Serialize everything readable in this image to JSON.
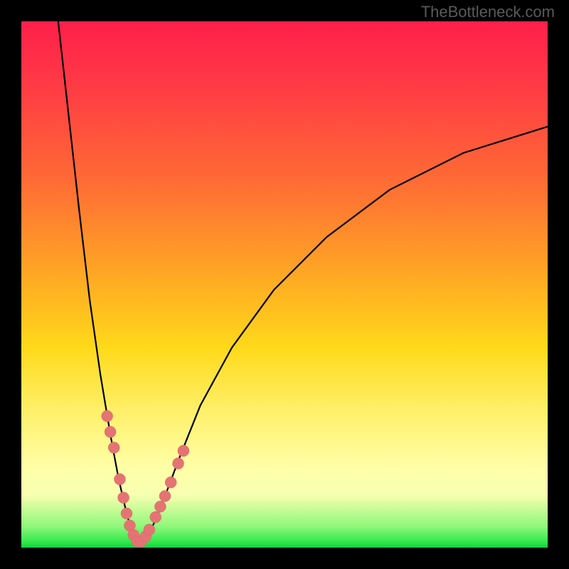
{
  "watermark": "TheBottleneck.com",
  "colors": {
    "frame": "#000000",
    "curve": "#000000",
    "marker_fill": "#e47473",
    "marker_stroke": "#d86462",
    "gradient_stops": [
      {
        "pos": 0,
        "hex": "#ff1f4a"
      },
      {
        "pos": 12,
        "hex": "#ff3a45"
      },
      {
        "pos": 30,
        "hex": "#ff6a35"
      },
      {
        "pos": 48,
        "hex": "#ffa724"
      },
      {
        "pos": 62,
        "hex": "#ffd91a"
      },
      {
        "pos": 74,
        "hex": "#fff06a"
      },
      {
        "pos": 85,
        "hex": "#ffffa8"
      },
      {
        "pos": 90,
        "hex": "#f7ffb0"
      },
      {
        "pos": 96,
        "hex": "#8ef77a"
      },
      {
        "pos": 99,
        "hex": "#2ee84c"
      },
      {
        "pos": 100,
        "hex": "#10d040"
      }
    ]
  },
  "chart_data": {
    "type": "line",
    "title": "",
    "xlabel": "",
    "ylabel": "",
    "xlim": [
      0,
      100
    ],
    "ylim": [
      0,
      100
    ],
    "note": "V-shaped bottleneck curve with vertex near x≈22, y≈0. Left branch from (7,100) down to vertex; right branch rises toward (100,80). Salmon markers cluster near the vertex on both branches.",
    "series": [
      {
        "name": "bottleneck_curve",
        "points": [
          {
            "x": 7.0,
            "y": 100.0
          },
          {
            "x": 9.0,
            "y": 82.0
          },
          {
            "x": 11.0,
            "y": 64.0
          },
          {
            "x": 13.0,
            "y": 47.0
          },
          {
            "x": 15.0,
            "y": 33.0
          },
          {
            "x": 17.0,
            "y": 21.0
          },
          {
            "x": 18.5,
            "y": 13.0
          },
          {
            "x": 20.0,
            "y": 6.5
          },
          {
            "x": 21.0,
            "y": 3.0
          },
          {
            "x": 22.0,
            "y": 1.0
          },
          {
            "x": 23.0,
            "y": 1.0
          },
          {
            "x": 24.5,
            "y": 3.0
          },
          {
            "x": 27.0,
            "y": 9.0
          },
          {
            "x": 30.0,
            "y": 17.0
          },
          {
            "x": 34.0,
            "y": 27.0
          },
          {
            "x": 40.0,
            "y": 38.0
          },
          {
            "x": 48.0,
            "y": 49.0
          },
          {
            "x": 58.0,
            "y": 59.0
          },
          {
            "x": 70.0,
            "y": 68.0
          },
          {
            "x": 84.0,
            "y": 75.0
          },
          {
            "x": 100.0,
            "y": 80.0
          }
        ]
      },
      {
        "name": "markers",
        "points": [
          {
            "x": 16.3,
            "y": 25.0
          },
          {
            "x": 16.9,
            "y": 22.0
          },
          {
            "x": 17.6,
            "y": 19.0
          },
          {
            "x": 18.7,
            "y": 13.0
          },
          {
            "x": 19.4,
            "y": 9.5
          },
          {
            "x": 20.0,
            "y": 6.5
          },
          {
            "x": 20.6,
            "y": 4.2
          },
          {
            "x": 21.3,
            "y": 2.4
          },
          {
            "x": 22.0,
            "y": 1.2
          },
          {
            "x": 22.8,
            "y": 1.2
          },
          {
            "x": 23.6,
            "y": 2.1
          },
          {
            "x": 24.3,
            "y": 3.4
          },
          {
            "x": 25.5,
            "y": 5.8
          },
          {
            "x": 26.4,
            "y": 7.8
          },
          {
            "x": 27.3,
            "y": 9.8
          },
          {
            "x": 28.4,
            "y": 12.4
          },
          {
            "x": 29.8,
            "y": 16.0
          },
          {
            "x": 30.8,
            "y": 18.4
          }
        ]
      }
    ]
  }
}
